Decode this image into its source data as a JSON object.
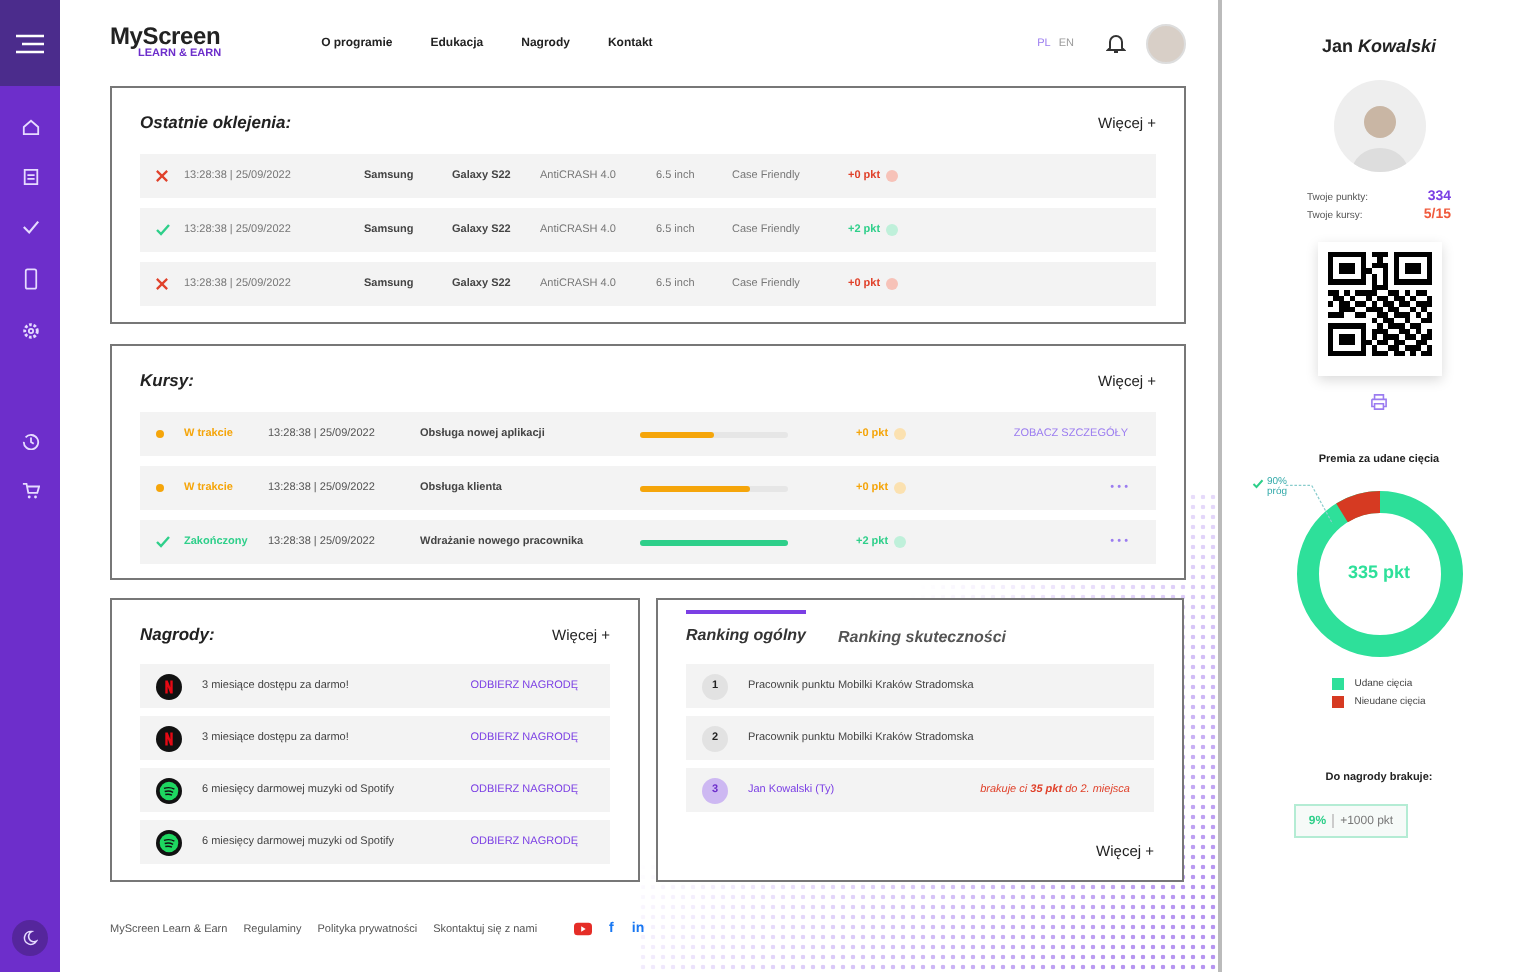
{
  "logo": {
    "name": "MyScreen",
    "tagline": "LEARN & EARN"
  },
  "nav": [
    "O programie",
    "Edukacja",
    "Nagrody",
    "Kontakt"
  ],
  "languages": [
    {
      "label": "PL",
      "selected": true
    },
    {
      "label": "EN",
      "selected": false
    }
  ],
  "recent": {
    "title": "Ostatnie oklejenia:",
    "more": "Więcej +",
    "rows": [
      {
        "success": false,
        "time": "13:28:38 | 25/09/2022",
        "brand": "Samsung",
        "model": "Galaxy S22",
        "product": "AntiCRASH 4.0",
        "size": "6.5 inch",
        "case": "Case Friendly",
        "points": "+0 pkt"
      },
      {
        "success": true,
        "time": "13:28:38 | 25/09/2022",
        "brand": "Samsung",
        "model": "Galaxy S22",
        "product": "AntiCRASH 4.0",
        "size": "6.5 inch",
        "case": "Case Friendly",
        "points": "+2 pkt"
      },
      {
        "success": false,
        "time": "13:28:38 | 25/09/2022",
        "brand": "Samsung",
        "model": "Galaxy S22",
        "product": "AntiCRASH 4.0",
        "size": "6.5 inch",
        "case": "Case Friendly",
        "points": "+0 pkt"
      }
    ]
  },
  "courses": {
    "title": "Kursy:",
    "more": "Więcej +",
    "rows": [
      {
        "kind": "in_progress",
        "status": "W trakcie",
        "time": "13:28:38 | 25/09/2022",
        "name": "Obsługa nowej aplikacji",
        "level": 0.5,
        "points": "+0 pkt",
        "action": "ZOBACZ SZCZEGÓŁY"
      },
      {
        "kind": "in_progress",
        "status": "W trakcie",
        "time": "13:28:38 | 25/09/2022",
        "name": "Obsługa klienta",
        "level": 0.74,
        "points": "+0 pkt",
        "action": "• • •"
      },
      {
        "kind": "done",
        "status": "Zakończony",
        "time": "13:28:38 | 25/09/2022",
        "name": "Wdrażanie nowego pracownika",
        "level": 1,
        "points": "+2 pkt",
        "action": "• • •"
      }
    ]
  },
  "rewards": {
    "title": "Nagrody:",
    "more": "Więcej +",
    "rows": [
      {
        "kind": "video",
        "text": "3 miesiące dostępu za darmo!",
        "action": "ODBIERZ NAGRODĘ"
      },
      {
        "kind": "video",
        "text": "3 miesiące dostępu za darmo!",
        "action": "ODBIERZ NAGRODĘ"
      },
      {
        "kind": "music",
        "text": "6 miesięcy darmowej muzyki od Spotify",
        "action": "ODBIERZ NAGRODĘ"
      },
      {
        "kind": "music",
        "text": "6 miesięcy darmowej muzyki od Spotify",
        "action": "ODBIERZ NAGRODĘ"
      }
    ]
  },
  "ranking": {
    "tabs": [
      {
        "label": "Ranking ogólny",
        "selected": true
      },
      {
        "label": "Ranking skuteczności",
        "selected": false
      }
    ],
    "more": "Więcej +",
    "rows": [
      {
        "place": "1",
        "name": "Pracownik punktu Mobilki Kraków Stradomska",
        "self": false
      },
      {
        "place": "2",
        "name": "Pracownik punktu Mobilki Kraków Stradomska",
        "self": false
      },
      {
        "place": "3",
        "name": "Jan Kowalski (Ty)",
        "self": true,
        "note": "brakuje ci **35 pkt** do 2. miejsca"
      }
    ]
  },
  "footer": {
    "links": [
      "MyScreen Learn & Earn",
      "Regulaminy",
      "Polityka prywatności",
      "Skontaktuj się z nami"
    ],
    "social": [
      {
        "kind": "video"
      },
      {
        "kind": "text",
        "label": "f"
      },
      {
        "kind": "text",
        "label": "in"
      }
    ]
  },
  "profile": {
    "name": "Jan *Kowalski*",
    "stats": [
      {
        "label": "Twoje punkty:",
        "value": "334",
        "color": "#7b3fe4"
      },
      {
        "label": "Twoje kursy:",
        "value": "5/15",
        "color": "#f05a3c"
      }
    ],
    "bonus_title": "Premia za udane cięcia",
    "bonus_value": "335 pkt",
    "threshold": [
      "90%",
      "próg"
    ],
    "legend": [
      {
        "label": "Udane cięcia",
        "color": "#2ee09a"
      },
      {
        "label": "Nieudane cięcia",
        "color": "#d63a22"
      }
    ],
    "missing_title": "Do nagrody brakuje:",
    "missing_percent": "9%",
    "missing_points": "+1000 pkt"
  }
}
